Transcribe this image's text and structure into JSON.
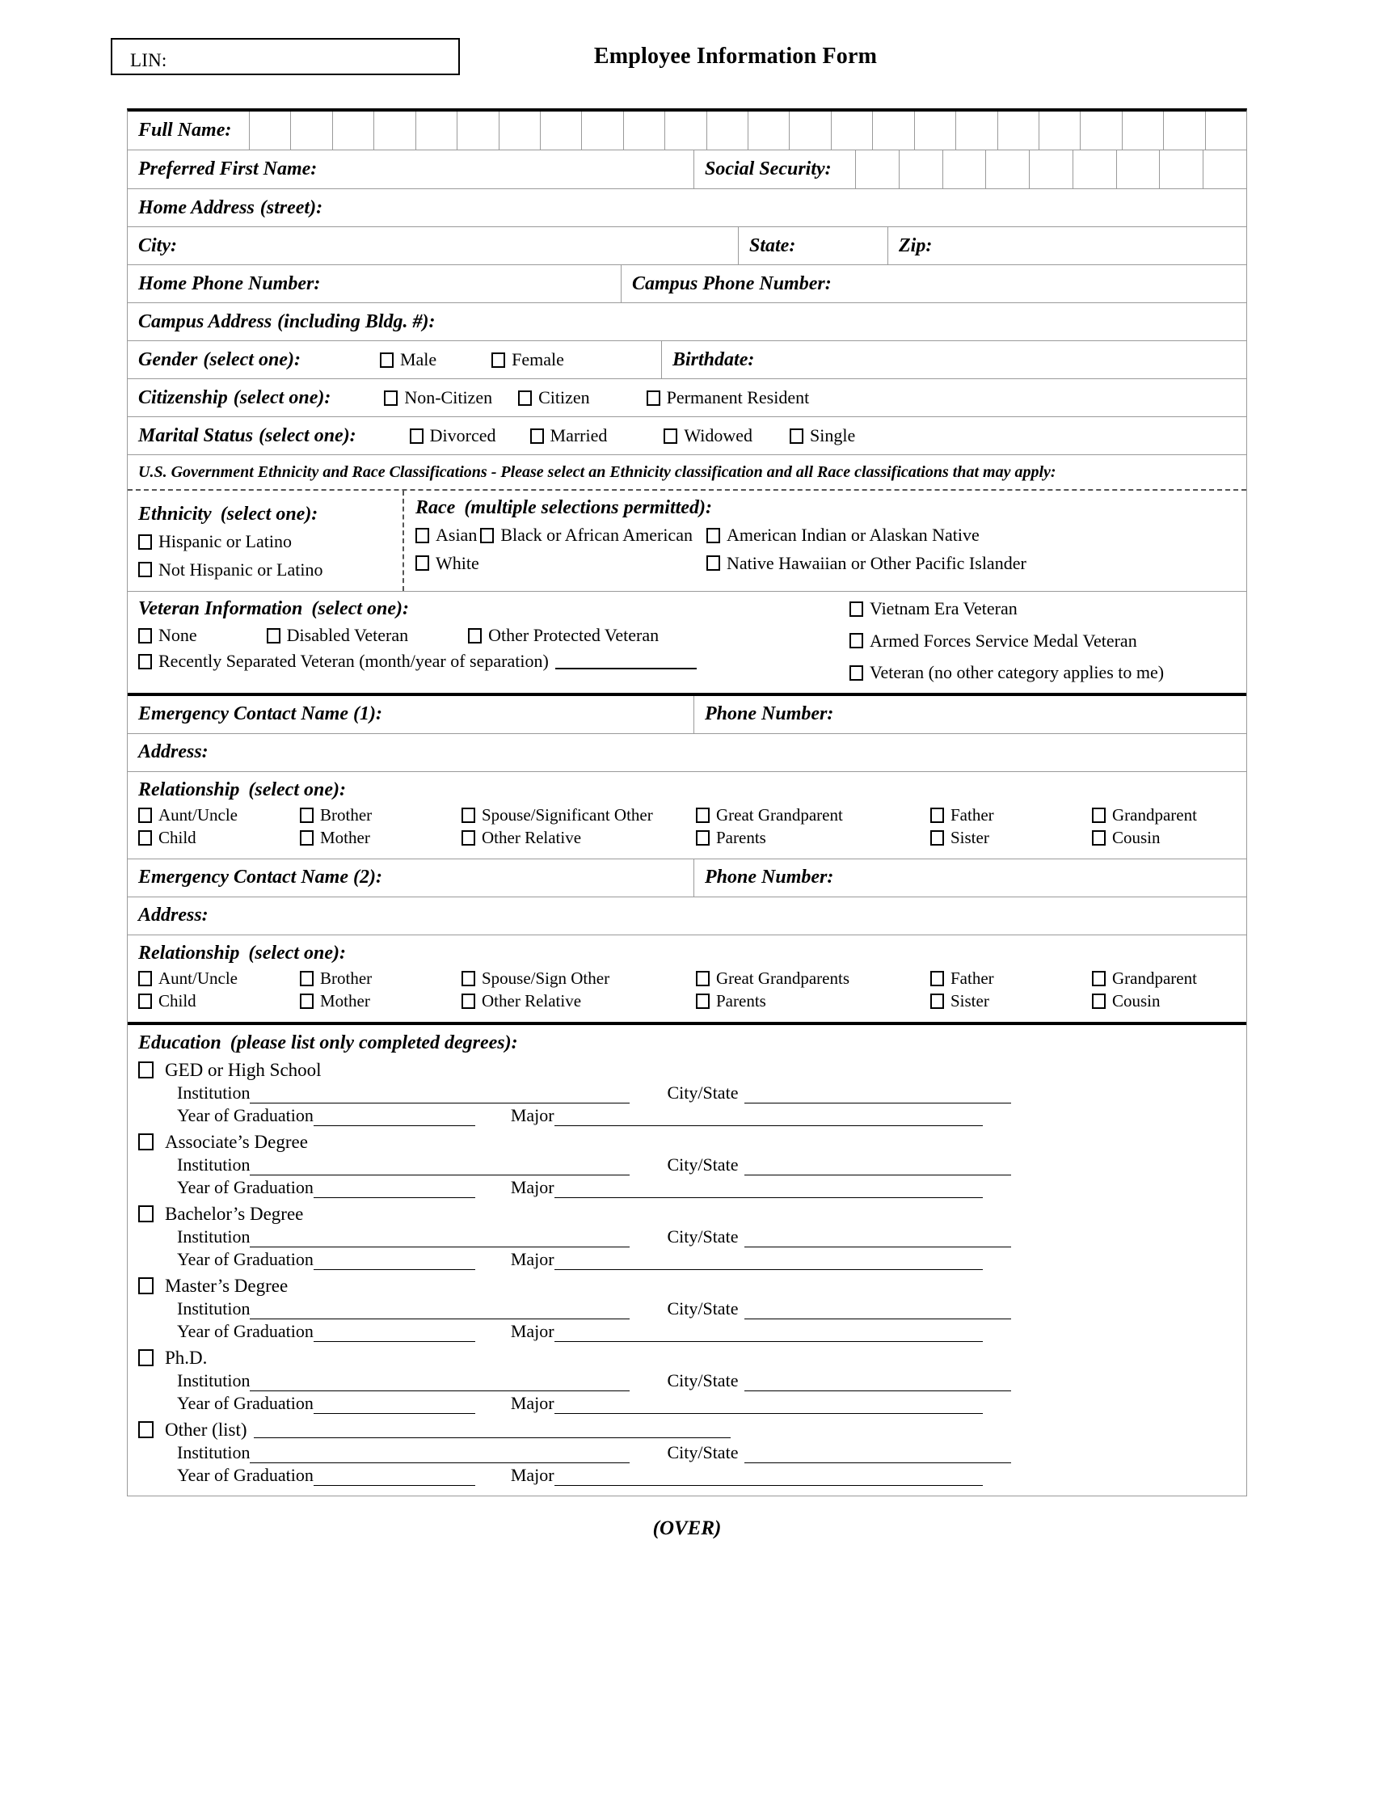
{
  "header": {
    "lin_label": "LIN:",
    "title": "Employee Information Form"
  },
  "fields": {
    "full_name": "Full Name:",
    "preferred_first_name": "Preferred First Name:",
    "social_security": "Social Security:",
    "home_address": "Home Address",
    "home_address_note": "(street):",
    "city": "City:",
    "state": "State:",
    "zip": "Zip:",
    "home_phone": "Home Phone Number:",
    "campus_phone": "Campus Phone Number:",
    "campus_address": "Campus Address",
    "campus_address_note": "(including Bldg. #):",
    "birthdate": "Birthdate:",
    "emergency_contact_1": "Emergency Contact Name (1):",
    "emergency_contact_2": "Emergency Contact Name (2):",
    "phone_number": "Phone Number:",
    "address": "Address:"
  },
  "grid_counts": {
    "full_name_cells": 24,
    "ssn_cells": 9
  },
  "gender": {
    "label": "Gender",
    "note": "(select one):",
    "options": [
      "Male",
      "Female"
    ]
  },
  "citizenship": {
    "label": "Citizenship",
    "note": "(select one):",
    "options": [
      "Non-Citizen",
      "Citizen",
      "Permanent Resident"
    ]
  },
  "marital_status": {
    "label": "Marital Status",
    "note": "(select one):",
    "options": [
      "Divorced",
      "Married",
      "Widowed",
      "Single"
    ]
  },
  "ethnicity_race": {
    "heading": "U.S. Government Ethnicity and Race Classifications -  Please select an Ethnicity classification and all Race classifications that may apply:",
    "ethnicity_label": "Ethnicity",
    "ethnicity_note": "(select one):",
    "ethnicity_options": [
      "Hispanic or Latino",
      "Not Hispanic or Latino"
    ],
    "race_label": "Race",
    "race_note": "(multiple selections permitted):",
    "race_options_col1": [
      "Asian",
      "Black or African American",
      "White"
    ],
    "race_options_col2": [
      "American Indian or Alaskan Native",
      "Native Hawaiian or Other Pacific Islander"
    ]
  },
  "veteran": {
    "label": "Veteran Information",
    "note": "(select one):",
    "left_row1": [
      "None",
      "Disabled Veteran",
      "Other Protected Veteran"
    ],
    "recently_separated": "Recently Separated Veteran (month/year of separation)",
    "right_options": [
      "Vietnam Era Veteran",
      "Armed Forces Service Medal Veteran",
      "Veteran (no other category applies to me)"
    ]
  },
  "relationship_1": {
    "label": "Relationship",
    "note": "(select one):",
    "columns": [
      [
        "Aunt/Uncle",
        "Child"
      ],
      [
        "Brother",
        "Mother"
      ],
      [
        "Spouse/Significant Other",
        "Other Relative"
      ],
      [
        "Great Grandparent",
        "Parents"
      ],
      [
        "Father",
        "Sister"
      ],
      [
        "Grandparent",
        "Cousin"
      ]
    ]
  },
  "relationship_2": {
    "label": "Relationship",
    "note": "(select one):",
    "columns": [
      [
        "Aunt/Uncle",
        "Child"
      ],
      [
        "Brother",
        "Mother"
      ],
      [
        "Spouse/Sign Other",
        "Other Relative"
      ],
      [
        "Great Grandparents",
        "Parents"
      ],
      [
        "Father",
        "Sister"
      ],
      [
        "Grandparent",
        "Cousin"
      ]
    ]
  },
  "education": {
    "label": "Education",
    "note": "(please list only completed degrees):",
    "line_labels": {
      "institution": "Institution",
      "city_state": "City/State",
      "year": "Year of Graduation",
      "major": "Major"
    },
    "entries": [
      {
        "degree": "GED or High School",
        "has_other_line": false
      },
      {
        "degree": "Associate’s Degree",
        "has_other_line": false
      },
      {
        "degree": "Bachelor’s Degree",
        "has_other_line": false
      },
      {
        "degree": "Master’s Degree",
        "has_other_line": false
      },
      {
        "degree": "Ph.D.",
        "has_other_line": false
      },
      {
        "degree": "Other (list)",
        "has_other_line": true
      }
    ]
  },
  "footer": {
    "over": "(OVER)"
  }
}
